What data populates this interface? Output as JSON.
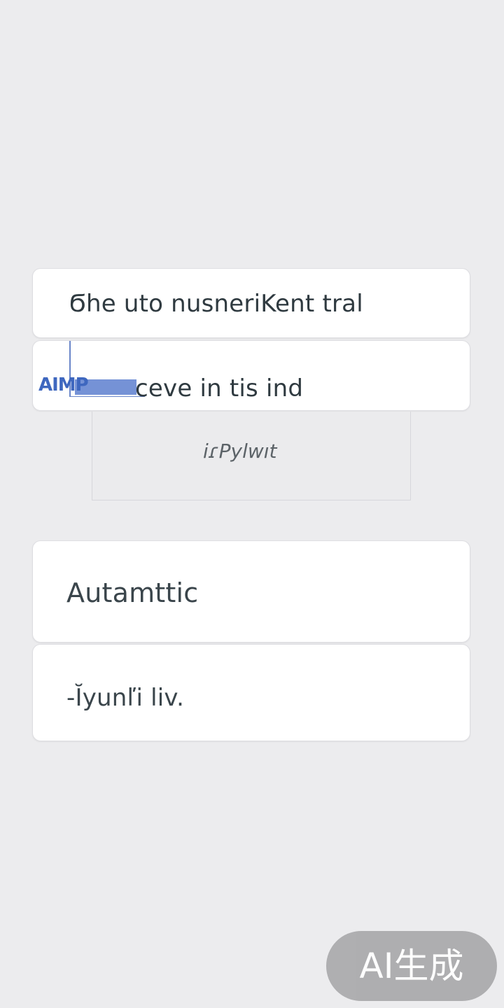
{
  "options": [
    {
      "label": "Ϭhe uto nusneriKent tral"
    },
    {
      "chip": "AIMP",
      "label": "ceve in tis ind"
    }
  ],
  "dropdown": {
    "label": "iɾPylwıt"
  },
  "settings": [
    {
      "label": "Autamttic"
    },
    {
      "label": "-Ĭyunľi liv."
    }
  ],
  "watermark": "AI生成",
  "colors": {
    "background": "#ececee",
    "card": "#ffffff",
    "accent_blue": "#5d7fcf",
    "watermark_bg": "#a9a9ab"
  }
}
